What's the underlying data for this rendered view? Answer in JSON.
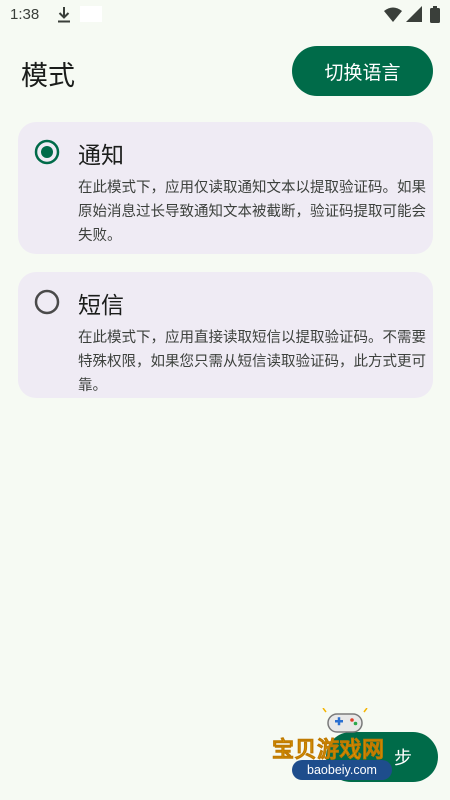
{
  "status_bar": {
    "time": "1:38",
    "icons": [
      "download-icon",
      "wifi-icon",
      "signal-icon",
      "battery-icon"
    ]
  },
  "header": {
    "title": "模式",
    "language_button": "切换语言"
  },
  "modes": [
    {
      "title": "通知",
      "selected": true,
      "description": "在此模式下，应用仅读取通知文本以提取验证码。如果原始消息过长导致通知文本被截断，验证码提取可能会失败。"
    },
    {
      "title": "短信",
      "selected": false,
      "description": "在此模式下，应用直接读取短信以提取验证码。不需要特殊权限，如果您只需从短信读取验证码，此方式更可靠。"
    }
  ],
  "footer": {
    "next_button": "步"
  },
  "watermark": {
    "text": "宝贝游戏网",
    "url": "baobeiy.com"
  },
  "colors": {
    "background": "#f6faf3",
    "primary": "#006b49",
    "card": "#efebf4",
    "radio_unselected": "#4a4a4a"
  }
}
